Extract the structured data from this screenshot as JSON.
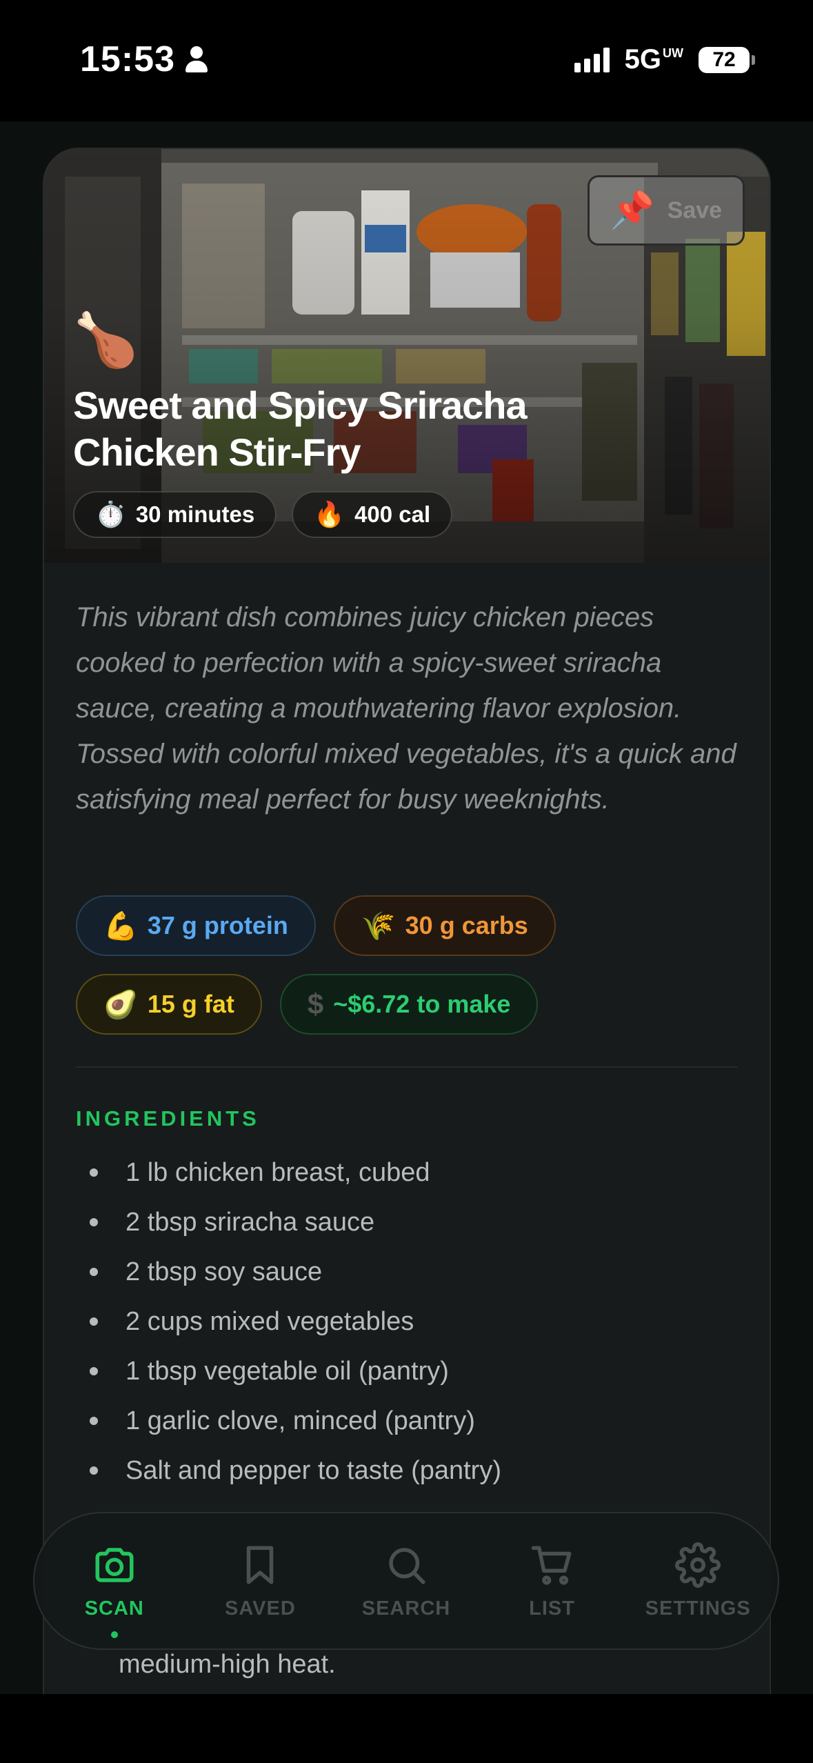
{
  "status_bar": {
    "time": "15:53",
    "network": "5G",
    "network_suffix": "UW",
    "battery": "72"
  },
  "recipe": {
    "save_label": "Save",
    "dish_emoji": "🍗",
    "title": "Sweet and Spicy Sriracha Chicken Stir-Fry",
    "time": "30 minutes",
    "time_emoji": "⏱️",
    "calories": "400 cal",
    "calories_emoji": "🔥",
    "description": "This vibrant dish combines juicy chicken pieces cooked to perfection with a spicy-sweet sriracha sauce, creating a mouthwatering flavor explosion. Tossed with colorful mixed vegetables, it's a quick and satisfying meal perfect for busy weeknights.",
    "macros": {
      "protein": "37 g protein",
      "protein_emoji": "💪",
      "carbs": "30 g carbs",
      "carbs_emoji": "🌾",
      "fat": "15 g fat",
      "fat_emoji": "🥑",
      "cost": "~$6.72 to make",
      "cost_symbol": "$"
    },
    "ingredients_heading": "INGREDIENTS",
    "ingredients": [
      "1 lb chicken breast, cubed",
      "2 tbsp sriracha sauce",
      "2 tbsp soy sauce",
      "2 cups mixed vegetables",
      "1 tbsp vegetable oil (pantry)",
      "1 garlic clove, minced (pantry)",
      "Salt and pepper to taste (pantry)"
    ],
    "step_tail": "medium-high heat."
  },
  "tabbar": {
    "tabs": [
      {
        "label": "SCAN",
        "icon": "camera-icon",
        "active": true
      },
      {
        "label": "SAVED",
        "icon": "bookmark-icon",
        "active": false
      },
      {
        "label": "SEARCH",
        "icon": "search-icon",
        "active": false
      },
      {
        "label": "LIST",
        "icon": "cart-icon",
        "active": false
      },
      {
        "label": "SETTINGS",
        "icon": "gear-icon",
        "active": false
      }
    ]
  },
  "colors": {
    "accent": "#22c55e",
    "protein": "#5aa9f3",
    "carbs": "#f0963a",
    "fat": "#f5d02c",
    "cost": "#2ecc71"
  }
}
